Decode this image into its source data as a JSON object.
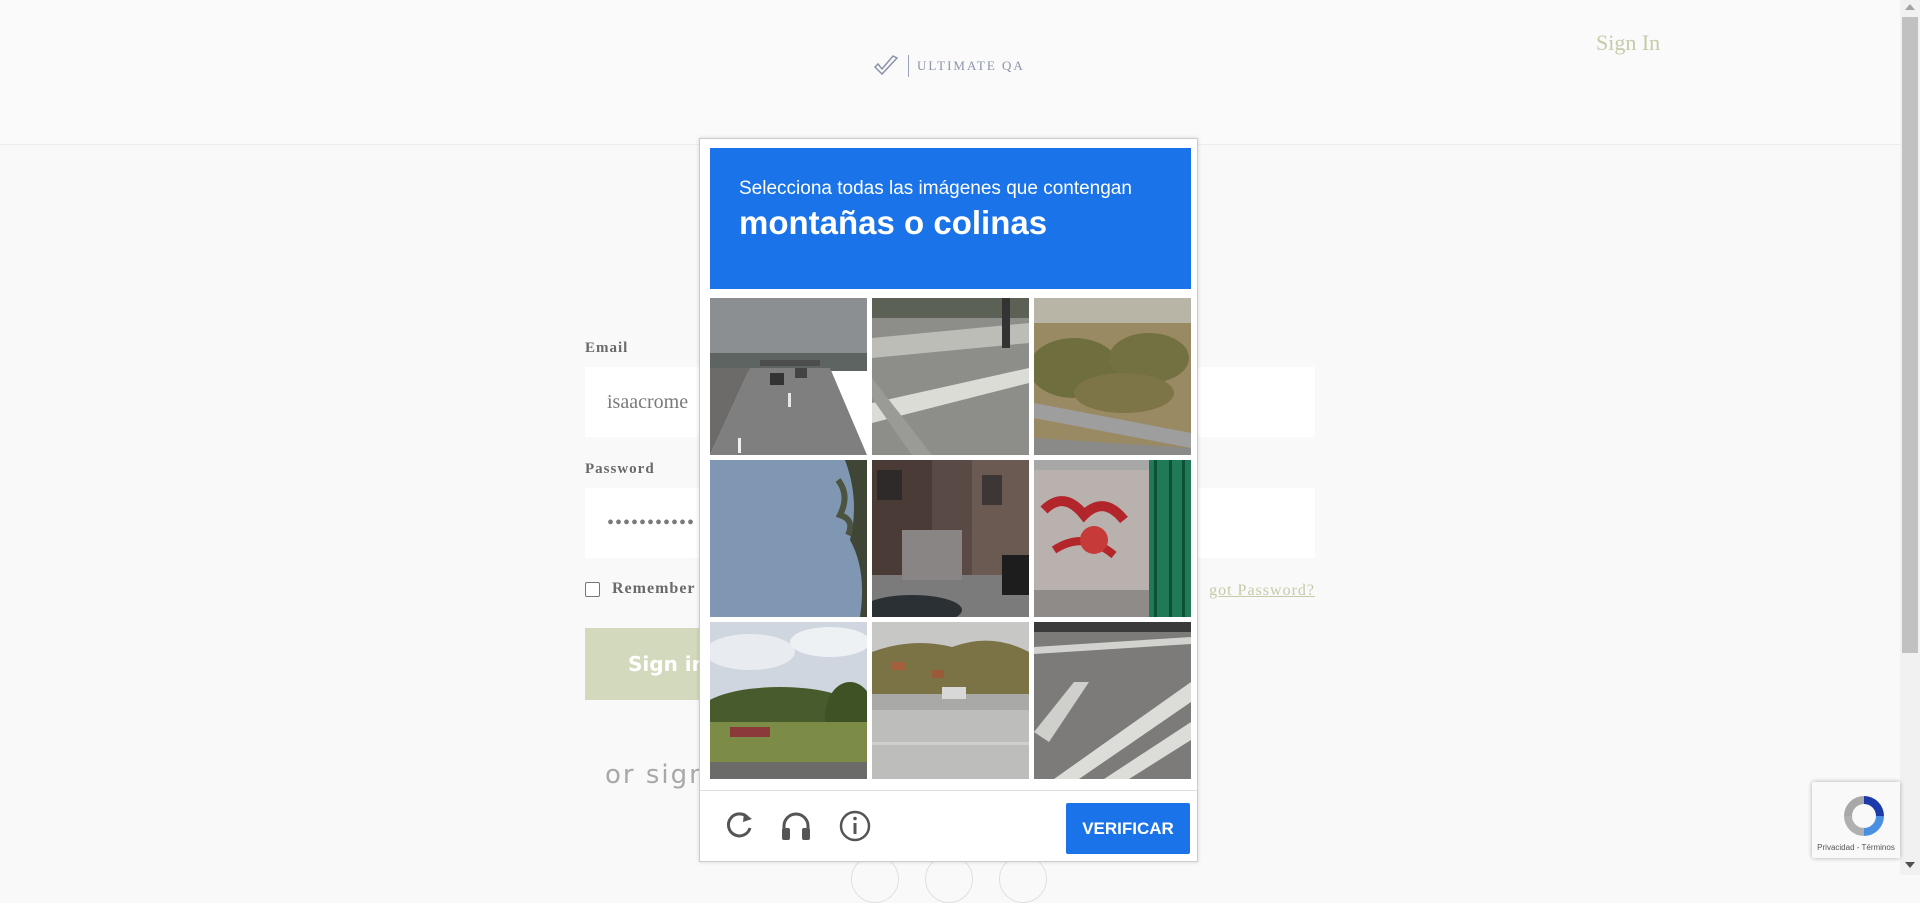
{
  "header": {
    "logo_text": "ULTIMATE QA",
    "signin_link": "Sign In"
  },
  "form": {
    "email_label": "Email",
    "email_value": "isaacrome",
    "password_label": "Password",
    "password_value": "•••••••••••",
    "remember_label": "Remember",
    "forgot_link": "got Password?",
    "signin_button": "Sign in",
    "or_sign": "or sign"
  },
  "captcha": {
    "instruction": "Selecciona todas las imágenes que contengan",
    "target": "montañas o colinas",
    "verify_button": "VERIFICAR",
    "icons": [
      "reload-icon",
      "headphones-icon",
      "info-icon"
    ],
    "accent_color": "#1a73e8"
  },
  "recaptcha_badge": {
    "links": "Privacidad - Términos"
  },
  "colors": {
    "brand_green": "#c5cba8",
    "button_green": "#d3d9bd",
    "captcha_blue": "#1a73e8"
  }
}
